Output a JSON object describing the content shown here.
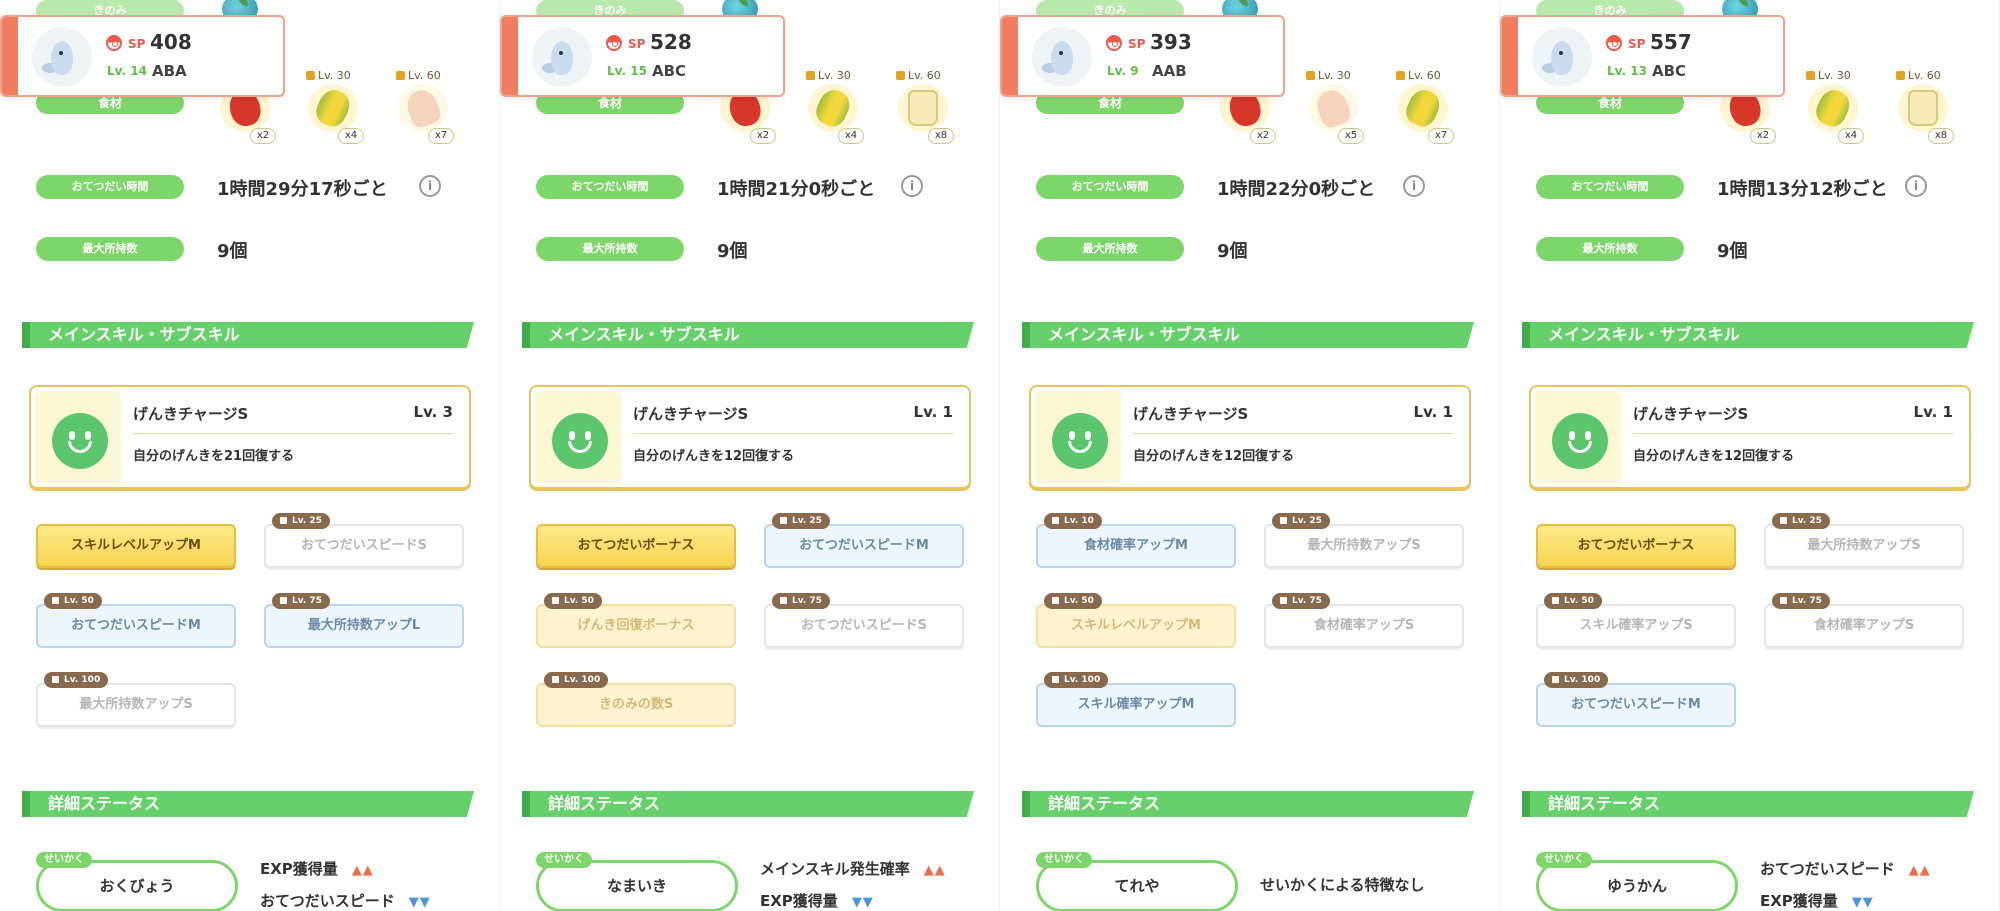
{
  "labels": {
    "top_label": "きのみ",
    "ingredients": "食材",
    "help_time": "おてつだい時間",
    "max_carry": "最大所持数",
    "skill_section": "メインスキル・サブスキル",
    "detail_section": "詳細ステータス",
    "nature_tag": "せいかく",
    "sp": "SP",
    "info_icon": "i"
  },
  "panels": [
    {
      "sp": "408",
      "level": "Lv. 14",
      "grade": "ABA",
      "ingredients": [
        {
          "type": "tomato",
          "lock": "",
          "qty": "x2"
        },
        {
          "type": "corn",
          "lock": "Lv. 30",
          "qty": "x4"
        },
        {
          "type": "mushroom",
          "lock": "Lv. 60",
          "qty": "x7"
        }
      ],
      "help_time": "1時間29分17秒ごと",
      "max_carry": "9個",
      "skill": {
        "name": "げんきチャージS",
        "level": "Lv. 3",
        "desc": "自分のげんきを21回復する"
      },
      "subskills": [
        {
          "label": "スキルレベルアップM",
          "lock": "",
          "style": "gold"
        },
        {
          "label": "おてつだいスピードS",
          "lock": "Lv. 25",
          "style": "white"
        },
        {
          "label": "おてつだいスピードM",
          "lock": "Lv. 50",
          "style": "blue"
        },
        {
          "label": "最大所持数アップL",
          "lock": "Lv. 75",
          "style": "blue"
        },
        {
          "label": "最大所持数アップS",
          "lock": "Lv. 100",
          "style": "white"
        }
      ],
      "nature": "おくびょう",
      "effects": [
        {
          "text": "EXP獲得量",
          "arrows": "▲▲",
          "dir": "up"
        },
        {
          "text": "おてつだいスピード",
          "arrows": "▼▼",
          "dir": "down"
        }
      ]
    },
    {
      "sp": "528",
      "level": "Lv. 15",
      "grade": "ABC",
      "ingredients": [
        {
          "type": "tomato",
          "lock": "",
          "qty": "x2"
        },
        {
          "type": "corn",
          "lock": "Lv. 30",
          "qty": "x4"
        },
        {
          "type": "jar",
          "lock": "Lv. 60",
          "qty": "x8"
        }
      ],
      "help_time": "1時間21分0秒ごと",
      "max_carry": "9個",
      "skill": {
        "name": "げんきチャージS",
        "level": "Lv. 1",
        "desc": "自分のげんきを12回復する"
      },
      "subskills": [
        {
          "label": "おてつだいボーナス",
          "lock": "",
          "style": "gold"
        },
        {
          "label": "おてつだいスピードM",
          "lock": "Lv. 25",
          "style": "blue"
        },
        {
          "label": "げんき回復ボーナス",
          "lock": "Lv. 50",
          "style": "gold dim"
        },
        {
          "label": "おてつだいスピードS",
          "lock": "Lv. 75",
          "style": "white"
        },
        {
          "label": "きのみの数S",
          "lock": "Lv. 100",
          "style": "gold dim"
        }
      ],
      "nature": "なまいき",
      "effects": [
        {
          "text": "メインスキル発生確率",
          "arrows": "▲▲",
          "dir": "up"
        },
        {
          "text": "EXP獲得量",
          "arrows": "▼▼",
          "dir": "down"
        }
      ]
    },
    {
      "sp": "393",
      "level": "Lv. 9",
      "grade": "AAB",
      "ingredients": [
        {
          "type": "tomato",
          "lock": "",
          "qty": "x2"
        },
        {
          "type": "mushroom",
          "lock": "Lv. 30",
          "qty": "x5"
        },
        {
          "type": "corn",
          "lock": "Lv. 60",
          "qty": "x7"
        }
      ],
      "help_time": "1時間22分0秒ごと",
      "max_carry": "9個",
      "skill": {
        "name": "げんきチャージS",
        "level": "Lv. 1",
        "desc": "自分のげんきを12回復する"
      },
      "subskills": [
        {
          "label": "食材確率アップM",
          "lock": "Lv. 10",
          "style": "blue"
        },
        {
          "label": "最大所持数アップS",
          "lock": "Lv. 25",
          "style": "white"
        },
        {
          "label": "スキルレベルアップM",
          "lock": "Lv. 50",
          "style": "gold dim"
        },
        {
          "label": "食材確率アップS",
          "lock": "Lv. 75",
          "style": "white"
        },
        {
          "label": "スキル確率アップM",
          "lock": "Lv. 100",
          "style": "blue"
        }
      ],
      "nature": "てれや",
      "effects": [
        {
          "text": "せいかくによる特徴なし",
          "arrows": "",
          "dir": ""
        }
      ]
    },
    {
      "sp": "557",
      "level": "Lv. 13",
      "grade": "ABC",
      "ingredients": [
        {
          "type": "tomato",
          "lock": "",
          "qty": "x2"
        },
        {
          "type": "corn",
          "lock": "Lv. 30",
          "qty": "x4"
        },
        {
          "type": "jar",
          "lock": "Lv. 60",
          "qty": "x8"
        }
      ],
      "help_time": "1時間13分12秒ごと",
      "max_carry": "9個",
      "skill": {
        "name": "げんきチャージS",
        "level": "Lv. 1",
        "desc": "自分のげんきを12回復する"
      },
      "subskills": [
        {
          "label": "おてつだいボーナス",
          "lock": "",
          "style": "gold"
        },
        {
          "label": "最大所持数アップS",
          "lock": "Lv. 25",
          "style": "white"
        },
        {
          "label": "スキル確率アップS",
          "lock": "Lv. 50",
          "style": "white"
        },
        {
          "label": "食材確率アップS",
          "lock": "Lv. 75",
          "style": "white"
        },
        {
          "label": "おてつだいスピードM",
          "lock": "Lv. 100",
          "style": "blue"
        }
      ],
      "nature": "ゆうかん",
      "effects": [
        {
          "text": "おてつだいスピード",
          "arrows": "▲▲",
          "dir": "up"
        },
        {
          "text": "EXP獲得量",
          "arrows": "▼▼",
          "dir": "down"
        }
      ]
    }
  ]
}
